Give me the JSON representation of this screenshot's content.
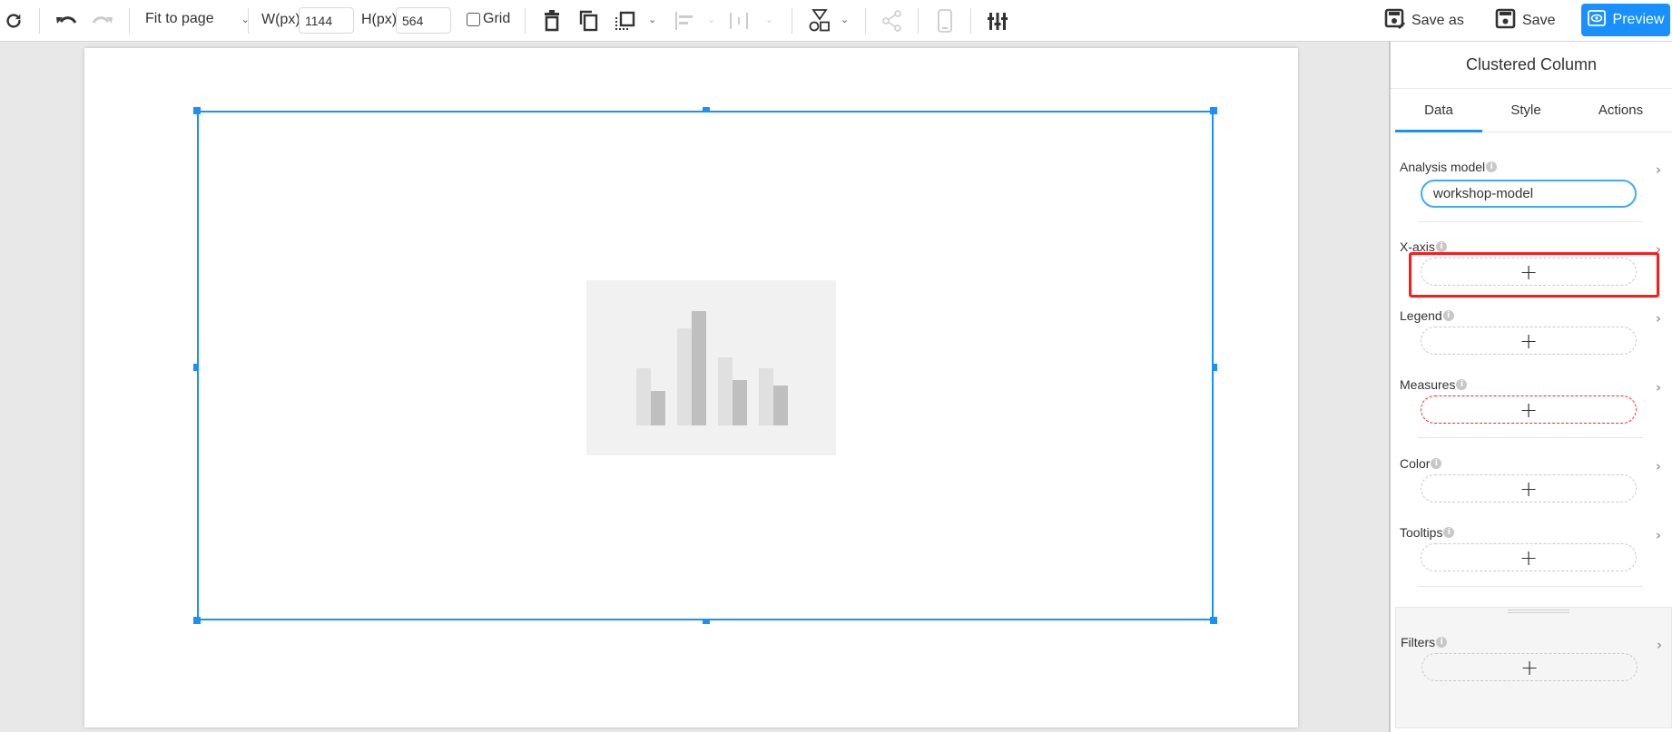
{
  "toolbar": {
    "zoom_select": "Fit to page",
    "width_label": "W(px)",
    "width_value": "1144",
    "height_label": "H(px)",
    "height_value": "564",
    "grid_label": "Grid",
    "grid_checked": false,
    "save_as_label": "Save as",
    "save_label": "Save",
    "preview_label": "Preview",
    "accent_color": "#1890ff",
    "icons": [
      "refresh-icon",
      "undo-icon",
      "redo-icon",
      "delete-icon",
      "copy-icon",
      "layer-icon",
      "align-left-icon",
      "distribute-icon",
      "shapes-icon",
      "share-icon",
      "mobile-icon",
      "settings-sliders-icon"
    ]
  },
  "canvas": {
    "selected_widget": "clustered-column-placeholder",
    "placeholder_chart": {
      "groups": [
        {
          "light": 0.42,
          "dark": 0.25
        },
        {
          "light": 0.71,
          "dark": 0.84
        },
        {
          "light": 0.5,
          "dark": 0.33
        },
        {
          "light": 0.42,
          "dark": 0.29
        }
      ]
    }
  },
  "panel": {
    "title": "Clustered Column",
    "tabs": [
      {
        "label": "Data",
        "active": true
      },
      {
        "label": "Style",
        "active": false
      },
      {
        "label": "Actions",
        "active": false
      }
    ],
    "analysis_model": {
      "label": "Analysis model",
      "value": "workshop-model"
    },
    "fields": [
      {
        "label": "X-axis",
        "required": false,
        "highlighted": true
      },
      {
        "label": "Legend",
        "required": false
      },
      {
        "label": "Measures",
        "required": true
      },
      {
        "label": "Color",
        "required": false
      },
      {
        "label": "Tooltips",
        "required": false
      }
    ],
    "filters": {
      "label": "Filters"
    },
    "info_glyph": "i",
    "plus_glyph": "+",
    "expand_glyph": "›"
  }
}
